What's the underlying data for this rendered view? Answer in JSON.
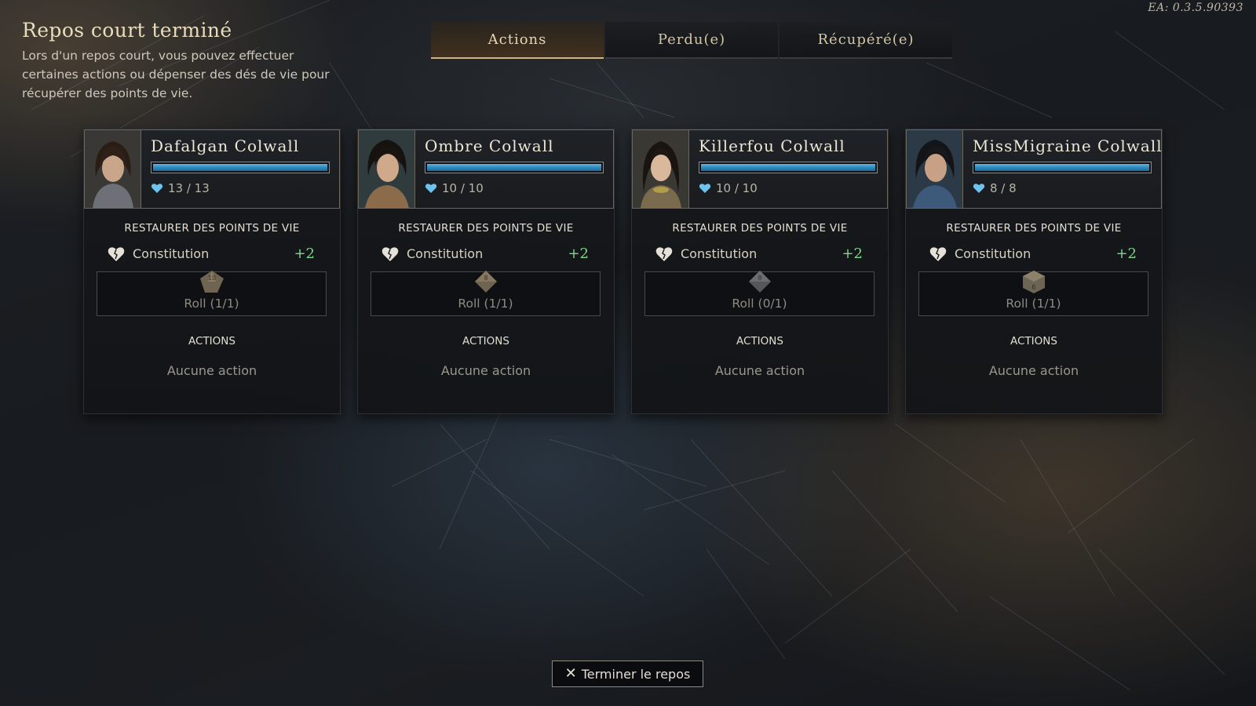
{
  "version": "EA: 0.3.5.90393",
  "header": {
    "title": "Repos court terminé",
    "subtitle": "Lors d'un repos court, vous pouvez effectuer certaines actions ou dépenser des dés de vie pour récupérer des points de vie."
  },
  "tabs": [
    {
      "label": "Actions",
      "active": true
    },
    {
      "label": "Perdu(e)",
      "active": false
    },
    {
      "label": "Récupéré(e)",
      "active": false
    }
  ],
  "characters": [
    {
      "name": "Dafalgan Colwall",
      "hp": "13 / 13",
      "hp_fraction": 1.0,
      "restore_title": "RESTAURER DES POINTS DE VIE",
      "stat": "Constitution",
      "bonus": "+2",
      "die_label": "10",
      "roll": "Roll (1/1)",
      "actions_title": "ACTIONS",
      "no_action": "Aucune action"
    },
    {
      "name": "Ombre Colwall",
      "hp": "10 / 10",
      "hp_fraction": 1.0,
      "restore_title": "RESTAURER DES POINTS DE VIE",
      "stat": "Constitution",
      "bonus": "+2",
      "die_label": "8",
      "roll": "Roll (1/1)",
      "actions_title": "ACTIONS",
      "no_action": "Aucune action"
    },
    {
      "name": "Killerfou Colwall",
      "hp": "10 / 10",
      "hp_fraction": 1.0,
      "restore_title": "RESTAURER DES POINTS DE VIE",
      "stat": "Constitution",
      "bonus": "+2",
      "die_label": "8",
      "roll": "Roll (0/1)",
      "actions_title": "ACTIONS",
      "no_action": "Aucune action"
    },
    {
      "name": "MissMigraine Colwall",
      "hp": "8 / 8",
      "hp_fraction": 1.0,
      "restore_title": "RESTAURER DES POINTS DE VIE",
      "stat": "Constitution",
      "bonus": "+2",
      "die_label": "6",
      "roll": "Roll (1/1)",
      "actions_title": "ACTIONS",
      "no_action": "Aucune action"
    }
  ],
  "end_button": {
    "icon": "close-icon",
    "label": "Terminer le repos"
  },
  "colors": {
    "accent": "#c9b68a",
    "hp_bar": "#2f86bc",
    "bonus": "#7fd88a",
    "title": "#e9dcbc"
  }
}
